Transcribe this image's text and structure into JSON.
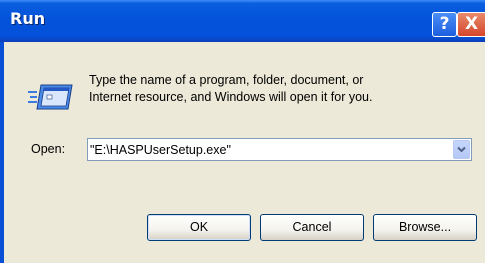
{
  "window": {
    "title": "Run",
    "help_label": "?",
    "close_label": "X"
  },
  "description": {
    "line1": "Type the name of a program, folder, document, or",
    "line2": "Internet resource, and Windows will open it for you."
  },
  "open_field": {
    "label": "Open:",
    "value": "\"E:\\HASPUserSetup.exe\""
  },
  "buttons": {
    "ok": "OK",
    "cancel": "Cancel",
    "browse": "Browse..."
  },
  "icons": {
    "run": "run-icon",
    "dropdown": "chevron-down-icon"
  },
  "colors": {
    "titlebar": "#0352d8",
    "dialog_bg": "#ece9d8",
    "close_button": "#d4452a"
  }
}
